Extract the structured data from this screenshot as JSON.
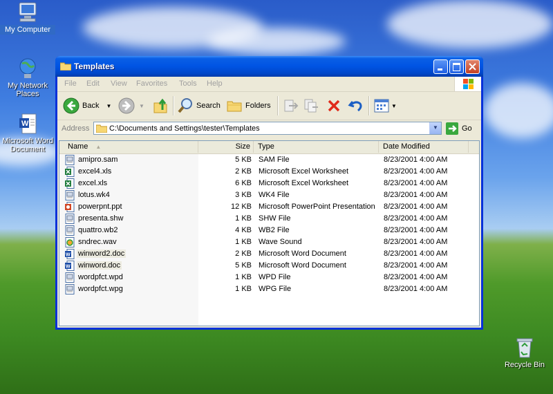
{
  "desktop": {
    "icons": [
      {
        "label": "My Computer"
      },
      {
        "label": "My Network Places"
      },
      {
        "label": "Microsoft Word Document"
      },
      {
        "label": "Recycle Bin"
      }
    ]
  },
  "window": {
    "title": "Templates",
    "menu": [
      "File",
      "Edit",
      "View",
      "Favorites",
      "Tools",
      "Help"
    ],
    "toolbar": {
      "back_label": "Back",
      "search_label": "Search",
      "folders_label": "Folders"
    },
    "address": {
      "label": "Address",
      "value": "C:\\Documents and Settings\\tester\\Templates",
      "go_label": "Go"
    },
    "columns": {
      "name": "Name",
      "size": "Size",
      "type": "Type",
      "date": "Date Modified"
    },
    "files": [
      {
        "name": "amipro.sam",
        "size": "5 KB",
        "type": "SAM File",
        "date": "8/23/2001 4:00 AM",
        "icon": "generic-file-icon"
      },
      {
        "name": "excel4.xls",
        "size": "2 KB",
        "type": "Microsoft Excel Worksheet",
        "date": "8/23/2001 4:00 AM",
        "icon": "excel-file-icon"
      },
      {
        "name": "excel.xls",
        "size": "6 KB",
        "type": "Microsoft Excel Worksheet",
        "date": "8/23/2001 4:00 AM",
        "icon": "excel-file-icon"
      },
      {
        "name": "lotus.wk4",
        "size": "3 KB",
        "type": "WK4 File",
        "date": "8/23/2001 4:00 AM",
        "icon": "generic-file-icon"
      },
      {
        "name": "powerpnt.ppt",
        "size": "12 KB",
        "type": "Microsoft PowerPoint Presentation",
        "date": "8/23/2001 4:00 AM",
        "icon": "powerpoint-file-icon"
      },
      {
        "name": "presenta.shw",
        "size": "1 KB",
        "type": "SHW File",
        "date": "8/23/2001 4:00 AM",
        "icon": "generic-file-icon"
      },
      {
        "name": "quattro.wb2",
        "size": "4 KB",
        "type": "WB2 File",
        "date": "8/23/2001 4:00 AM",
        "icon": "generic-file-icon"
      },
      {
        "name": "sndrec.wav",
        "size": "1 KB",
        "type": "Wave Sound",
        "date": "8/23/2001 4:00 AM",
        "icon": "sound-file-icon"
      },
      {
        "name": "winword2.doc",
        "size": "2 KB",
        "type": "Microsoft Word Document",
        "date": "8/23/2001 4:00 AM",
        "icon": "word-file-icon"
      },
      {
        "name": "winword.doc",
        "size": "5 KB",
        "type": "Microsoft Word Document",
        "date": "8/23/2001 4:00 AM",
        "icon": "word-file-icon"
      },
      {
        "name": "wordpfct.wpd",
        "size": "1 KB",
        "type": "WPD File",
        "date": "8/23/2001 4:00 AM",
        "icon": "generic-file-icon"
      },
      {
        "name": "wordpfct.wpg",
        "size": "1 KB",
        "type": "WPG File",
        "date": "8/23/2001 4:00 AM",
        "icon": "generic-file-icon"
      }
    ]
  },
  "colors": {
    "titlebar": "#0054e3",
    "selection": "#316ac5",
    "window_face": "#ece9d8"
  }
}
